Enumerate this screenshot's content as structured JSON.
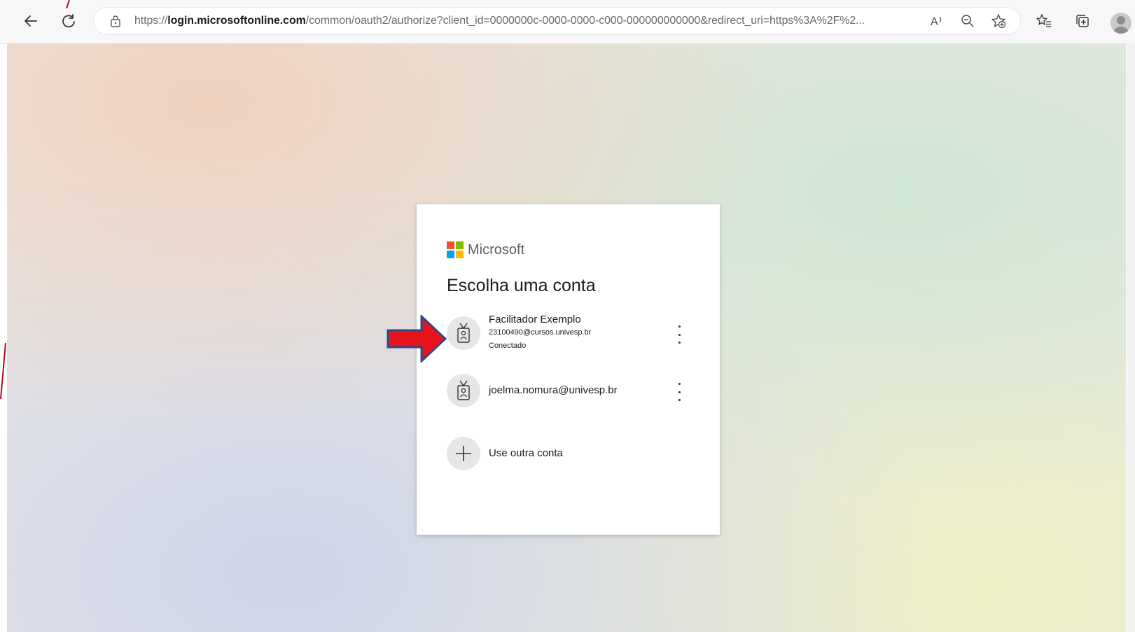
{
  "browser": {
    "url_scheme": "https://",
    "url_host": "login.microsoftonline.com",
    "url_rest": "/common/oauth2/authorize?client_id=0000000c-0000-0000-c000-000000000000&redirect_uri=https%3A%2F%2...",
    "read_aloud_icon": "read-aloud-icon",
    "zoom_icon": "zoom-icon",
    "favorite_icon": "add-favorite-icon",
    "favorites_icon": "favorites-icon",
    "collections_icon": "collections-icon",
    "profile_icon": "profile-icon"
  },
  "card": {
    "brand": "Microsoft",
    "title": "Escolha uma conta",
    "accounts": [
      {
        "name": "Facilitador Exemplo",
        "email": "23100490@cursos.univesp.br",
        "status": "Conectado"
      },
      {
        "email": "joelma.nomura@univesp.br"
      }
    ],
    "other_account_label": "Use outra conta"
  },
  "colors": {
    "ms_red": "#f25022",
    "ms_green": "#7fba00",
    "ms_blue": "#00a4ef",
    "ms_yellow": "#ffb900",
    "arrow_red": "#e8141c",
    "arrow_outline": "#2e4a8c"
  }
}
